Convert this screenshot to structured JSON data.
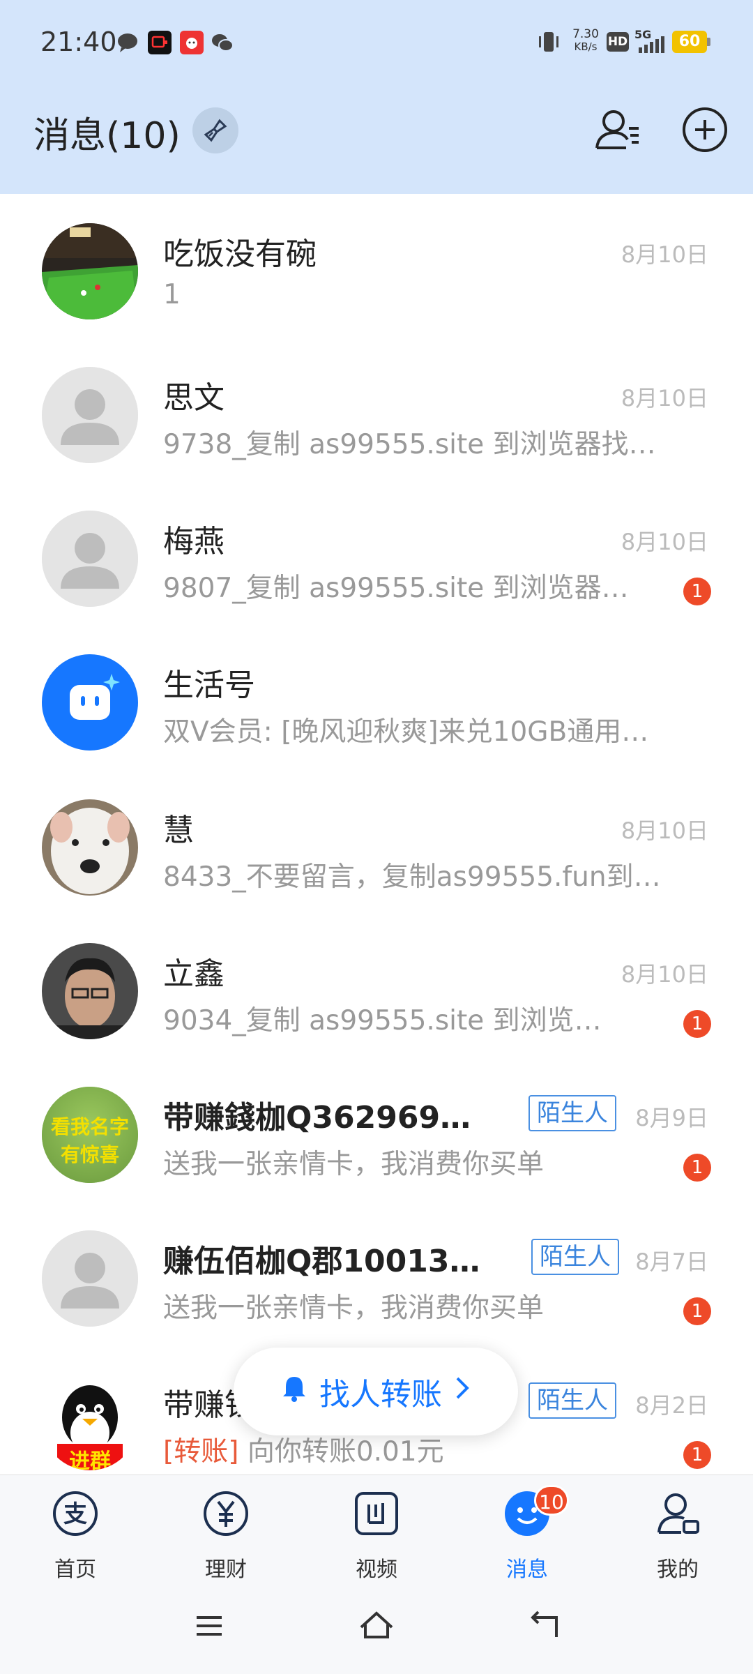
{
  "status_bar": {
    "time": "21:40",
    "net_speed_top": "7.30",
    "net_speed_bottom": "KB/s",
    "hd": "HD",
    "signal": "5G",
    "battery": "60",
    "icons": [
      "chat-bubble-icon",
      "video-app-icon",
      "red-app-icon",
      "wechat-icon",
      "vibrate-icon",
      "hd-icon",
      "signal-icon",
      "battery-icon"
    ]
  },
  "header": {
    "title": "消息(10)",
    "icons": [
      "broom-clean-icon",
      "contacts-icon",
      "add-circle-icon"
    ]
  },
  "conversations": [
    {
      "name": "吃饭没有碗",
      "preview": "1",
      "date": "8月10日",
      "badge": null,
      "tag": null,
      "avatar": "billiards-photo"
    },
    {
      "name": "思文",
      "preview": "9738_复制 as99555.site 到浏览器找…",
      "date": "8月10日",
      "badge": null,
      "tag": null,
      "avatar": "default-person"
    },
    {
      "name": "梅燕",
      "preview": "9807_复制 as99555.site 到浏览器…",
      "date": "8月10日",
      "badge": "1",
      "tag": null,
      "avatar": "default-person"
    },
    {
      "name": "生活号",
      "preview": "双V会员: [晚风迎秋爽]来兑10GB通用…",
      "date": "",
      "badge": null,
      "tag": null,
      "avatar": "life-account-logo"
    },
    {
      "name": "慧",
      "preview": "8433_不要留言，复制as99555.fun到…",
      "date": "8月10日",
      "badge": null,
      "tag": null,
      "avatar": "dog-photo"
    },
    {
      "name": "立鑫",
      "preview": "9034_复制 as99555.site 到浏览…",
      "date": "8月10日",
      "badge": "1",
      "tag": null,
      "avatar": "man-photo"
    },
    {
      "name": "带赚錢枷Q3629695…",
      "preview": "送我一张亲情卡，我消费你买单",
      "date": "8月9日",
      "badge": "1",
      "tag": "陌生人",
      "avatar": "text-avatar",
      "avatar_text": [
        "看我名字",
        "有惊喜"
      ]
    },
    {
      "name": "赚伍佰枷Q郡100132…",
      "preview": "送我一张亲情卡，我消费你买单",
      "date": "8月7日",
      "badge": "1",
      "tag": "陌生人",
      "avatar": "default-person"
    },
    {
      "name": "带赚钱",
      "preview_prefix": "[转账]",
      "preview": "向你转账0.01元",
      "date": "8月2日",
      "badge": "1",
      "tag": "陌生人",
      "avatar": "qq-penguin",
      "avatar_text": [
        "进群"
      ]
    }
  ],
  "floating_button": {
    "label": "找人转账"
  },
  "bottom_nav": {
    "items": [
      {
        "label": "首页",
        "icon": "alipay-icon"
      },
      {
        "label": "理财",
        "icon": "yuan-icon"
      },
      {
        "label": "视频",
        "icon": "video-icon"
      },
      {
        "label": "消息",
        "icon": "message-icon",
        "badge": "10",
        "active": true
      },
      {
        "label": "我的",
        "icon": "profile-icon"
      }
    ]
  },
  "colors": {
    "accent": "#1677ff",
    "header_bg": "#d4e5fb",
    "badge": "#ee4a28"
  }
}
